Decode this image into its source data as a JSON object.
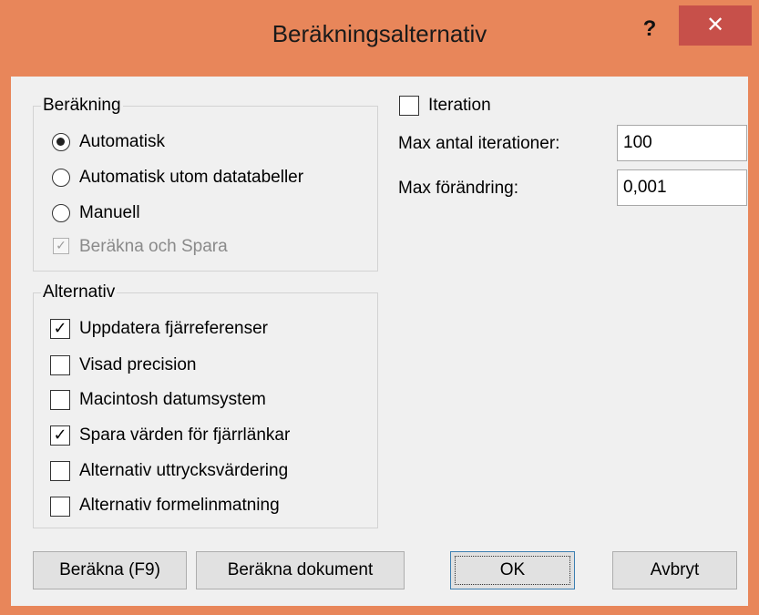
{
  "window": {
    "title": "Beräkningsalternativ",
    "help": "?",
    "close": "✕"
  },
  "calculation": {
    "group_title": "Beräkning",
    "automatic": "Automatisk",
    "automatic_except_tables": "Automatisk utom datatabeller",
    "manual": "Manuell",
    "recalc_before_save": "Beräkna och Spara",
    "selected": "automatic"
  },
  "options": {
    "group_title": "Alternativ",
    "items": [
      {
        "label": "Uppdatera fjärreferenser",
        "checked": true
      },
      {
        "label": "Visad precision",
        "checked": false
      },
      {
        "label": "Macintosh datumsystem",
        "checked": false
      },
      {
        "label": "Spara värden för fjärrlänkar",
        "checked": true
      },
      {
        "label": "Alternativ uttrycksvärdering",
        "checked": false
      },
      {
        "label": "Alternativ formelinmatning",
        "checked": false
      }
    ]
  },
  "iteration": {
    "label": "Iteration",
    "checked": false,
    "max_iterations_label": "Max antal iterationer:",
    "max_iterations_value": "100",
    "max_change_label": "Max förändring:",
    "max_change_value": "0,001"
  },
  "buttons": {
    "calc_now": "Beräkna (F9)",
    "calc_document": "Beräkna dokument",
    "ok": "OK",
    "cancel": "Avbryt"
  },
  "colors": {
    "title_bar": "#e8865a",
    "close_button": "#c7504a"
  }
}
